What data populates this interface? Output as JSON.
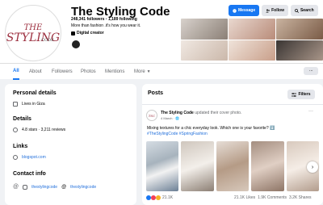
{
  "page": {
    "logo_text": {
      "the": "THE",
      "styling": "STYLING",
      "code": "CODE"
    },
    "title": "The Styling Code",
    "followers": "248,341 followers",
    "separator": " • ",
    "following": "1,189 following",
    "tagline": "More than fashion .it's how you wear it.",
    "category": "Digital creator"
  },
  "actions": {
    "message": "Message",
    "follow": "Follow",
    "search": "Search"
  },
  "tabs": [
    "All",
    "About",
    "Followers",
    "Photos",
    "Mentions",
    "More"
  ],
  "more_menu": "···",
  "about": {
    "personal_details_title": "Personal details",
    "lives_in": "Lives in Giza",
    "details_title": "Details",
    "rating": "4.8 stars · 3,211 reviews",
    "links_title": "Links",
    "link": "blogspot.com",
    "contact_title": "Contact info",
    "instagram": "thestylingcode",
    "threads": "thestylingcode"
  },
  "posts": {
    "title": "Posts",
    "filters": "Filters",
    "post": {
      "author": "The Styling Code",
      "action": " updated their cover photo.",
      "date": "4 March · ",
      "menu": "···",
      "text": "Mixing textures for a chic everyday look. Which one is your favorite? ⬇️",
      "tags": "#TheStylingCode #SpringFashion",
      "reactions_count": "21.1K",
      "likes": "21.1K Likes",
      "comments": "1.9K Comments",
      "shares": "3.2K Shares"
    }
  },
  "colors": {
    "accent": "#1877f2",
    "brand": "#9c2f3f",
    "background": "#f0f2f5"
  }
}
